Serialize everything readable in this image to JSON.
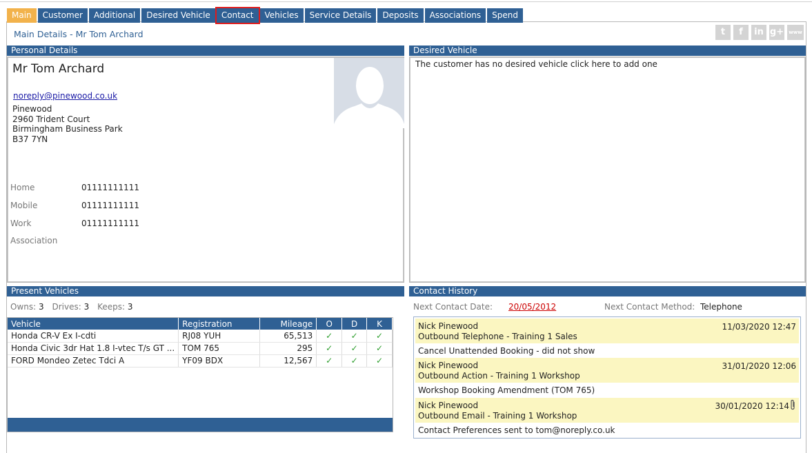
{
  "tabs": [
    {
      "label": "Main"
    },
    {
      "label": "Customer"
    },
    {
      "label": "Additional"
    },
    {
      "label": "Desired Vehicle"
    },
    {
      "label": "Contact"
    },
    {
      "label": "Vehicles"
    },
    {
      "label": "Service Details"
    },
    {
      "label": "Deposits"
    },
    {
      "label": "Associations"
    },
    {
      "label": "Spend"
    }
  ],
  "page_title": "Main Details - Mr Tom Archard",
  "social": {
    "twitter": "t",
    "facebook": "f",
    "linkedin": "in",
    "googleplus": "g+",
    "web": "www"
  },
  "personal": {
    "heading": "Personal Details",
    "name": "Mr Tom Archard",
    "email": "noreply@pinewood.co.uk",
    "address": [
      "Pinewood",
      "2960 Trident Court",
      "Birmingham Business Park",
      "B37 7YN"
    ],
    "phones": [
      {
        "label": "Home",
        "value": "01111111111"
      },
      {
        "label": "Mobile",
        "value": "01111111111"
      },
      {
        "label": "Work",
        "value": "01111111111"
      },
      {
        "label": "Association",
        "value": ""
      }
    ]
  },
  "desired": {
    "heading": "Desired Vehicle",
    "message": "The customer has no desired vehicle click here to add one"
  },
  "present": {
    "heading": "Present Vehicles",
    "owns_label": "Owns:",
    "owns": "3",
    "drives_label": "Drives:",
    "drives": "3",
    "keeps_label": "Keeps:",
    "keeps": "3",
    "columns": [
      "Vehicle",
      "Registration",
      "Mileage",
      "O",
      "D",
      "K"
    ],
    "rows": [
      {
        "vehicle": "Honda CR-V Ex I-cdti",
        "reg": "RJ08 YUH",
        "mileage": "65,513",
        "o": "✓",
        "d": "✓",
        "k": "✓"
      },
      {
        "vehicle": "Honda Civic 3dr Hat 1.8 I-vtec T/s GT ...",
        "reg": "TOM 765",
        "mileage": "295",
        "o": "✓",
        "d": "✓",
        "k": "✓"
      },
      {
        "vehicle": "FORD Mondeo Zetec Tdci A",
        "reg": "YF09 BDX",
        "mileage": "12,567",
        "o": "✓",
        "d": "✓",
        "k": "✓"
      }
    ]
  },
  "contact": {
    "heading": "Contact History",
    "next_date_label": "Next Contact Date:",
    "next_date": "20/05/2012",
    "next_method_label": "Next Contact Method:",
    "next_method": "Telephone",
    "entries": [
      {
        "who": "Nick Pinewood",
        "what": "Outbound Telephone - Training 1 Sales",
        "when": "11/03/2020 12:47",
        "note": "Cancel Unattended Booking - did not show"
      },
      {
        "who": "Nick Pinewood",
        "what": "Outbound Action - Training 1 Workshop",
        "when": "31/01/2020 12:06",
        "note": "Workshop Booking Amendment (TOM 765)"
      },
      {
        "who": "Nick Pinewood",
        "what": "Outbound Email - Training 1 Workshop",
        "when": "30/01/2020 12:14",
        "note": "Contact Preferences sent to tom@noreply.co.uk"
      }
    ]
  }
}
